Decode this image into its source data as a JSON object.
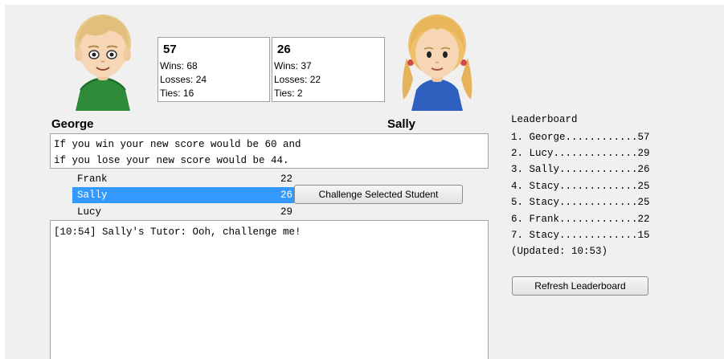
{
  "player": {
    "name": "George",
    "score": "57",
    "wins": "Wins: 68",
    "losses": "Losses: 24",
    "ties": "Ties: 16",
    "avatar_icon": "boy-avatar-icon"
  },
  "opponent": {
    "name": "Sally",
    "score": "26",
    "wins": "Wins: 37",
    "losses": "Losses: 22",
    "ties": "Ties: 2",
    "avatar_icon": "girl-avatar-icon"
  },
  "outcome_message": {
    "line1": "If you win your new score would be 60 and",
    "line2": "if you lose your new score would be 44."
  },
  "students": [
    {
      "name": "Frank",
      "score": "22",
      "selected": false
    },
    {
      "name": "Sally",
      "score": "26",
      "selected": true
    },
    {
      "name": "Lucy",
      "score": "29",
      "selected": false
    }
  ],
  "challenge_button_label": "Challenge Selected Student",
  "chat": {
    "lines": [
      "[10:54] Sally's Tutor: Ooh, challenge me!"
    ]
  },
  "leaderboard": {
    "title": "Leaderboard",
    "entries": [
      "1. George............57",
      "2. Lucy..............29",
      "3. Sally.............26",
      "4. Stacy.............25",
      "5. Stacy.............25",
      "6. Frank.............22",
      "7. Stacy.............15"
    ],
    "updated": "(Updated: 10:53)",
    "refresh_label": "Refresh Leaderboard"
  },
  "colors": {
    "panel_background": "#f0f0f0",
    "selection_highlight": "#3399ff",
    "border": "#a0a0a0"
  }
}
